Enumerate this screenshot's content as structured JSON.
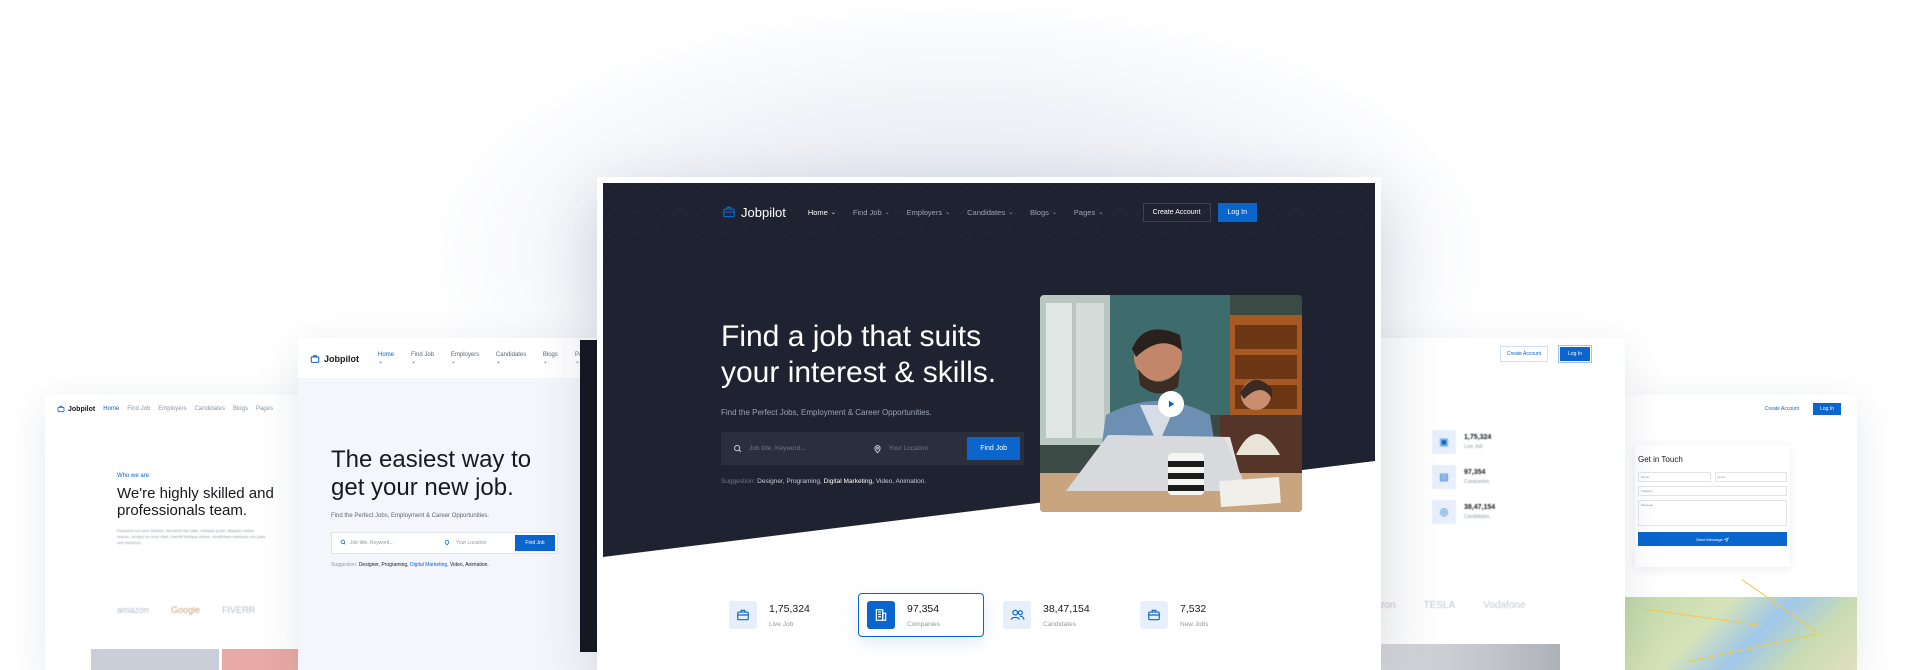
{
  "colors": {
    "brand": "#0a65cc",
    "dark_hero": "#1f2230",
    "text": "#18191c",
    "muted": "#9199a3"
  },
  "main": {
    "logo": "Jobpilot",
    "nav": [
      {
        "label": "Home",
        "active": true
      },
      {
        "label": "Find Job"
      },
      {
        "label": "Employers"
      },
      {
        "label": "Candidates"
      },
      {
        "label": "Blogs"
      },
      {
        "label": "Pages"
      }
    ],
    "create_account": "Create Account",
    "login": "Log In",
    "hero_title": "Find a job that suits your interest & skills.",
    "hero_subtitle": "Find the Perfect Jobs, Employment & Career Opportunities.",
    "search": {
      "keyword_placeholder": "Job title, Keyword...",
      "location_placeholder": "Your Location",
      "button": "Find Job"
    },
    "suggestion_label": "Suggestion:",
    "suggestions": [
      "Designer,",
      "Programing,",
      "Digital Marketing,",
      "Video,",
      "Animation."
    ],
    "stats": [
      {
        "value": "1,75,324",
        "label": "Live Job",
        "icon": "briefcase-icon"
      },
      {
        "value": "97,354",
        "label": "Companies",
        "icon": "building-icon"
      },
      {
        "value": "38,47,154",
        "label": "Candidates",
        "icon": "users-icon"
      },
      {
        "value": "7,532",
        "label": "New Jobs",
        "icon": "briefcase-icon"
      }
    ]
  },
  "left": {
    "logo": "Jobpilot",
    "nav": [
      "Home",
      "Find Job",
      "Employers",
      "Candidates",
      "Blogs",
      "Pages"
    ],
    "title": "The easiest way to get your new job.",
    "subtitle": "Find the Perfect Jobs, Employment & Career Opportunities.",
    "keyword_placeholder": "Job title, Keyword...",
    "location_placeholder": "Your Location",
    "button": "Find Job",
    "suggestion_label": "Suggestion:",
    "suggestions": [
      "Designer,",
      "Programing,",
      "Digital Marketing,",
      "Video,",
      "Animation."
    ]
  },
  "far_left": {
    "logo": "Jobpilot",
    "nav": [
      "Home",
      "Find Job",
      "Employers",
      "Candidates",
      "Blogs",
      "Pages"
    ],
    "kicker": "Who we are",
    "title": "We're highly skilled and professionals team.",
    "paragraph": "Praesent non sem facilisis, hendrerit nisi vitae, volutpat quam. Aliquam metus mauris, semper eu eros vitae, blandit tristique metus. Vestibulum maximus nec justo sed maximus.",
    "brands": [
      "amazon",
      "Google",
      "FIVERR"
    ]
  },
  "right": {
    "create_account": "Create Account",
    "login": "Log In",
    "stats": [
      {
        "value": "1,75,324",
        "label": "Live Job"
      },
      {
        "value": "97,354",
        "label": "Companies"
      },
      {
        "value": "38,47,154",
        "label": "Candidates"
      }
    ],
    "logos": [
      "amazon",
      "TESLA",
      "Vodafone"
    ]
  },
  "far_right": {
    "create_account": "Create Account",
    "login": "Log In",
    "form_title": "Get in Touch",
    "name_ph": "Name",
    "email_ph": "Email",
    "subject_ph": "Subjects",
    "message_ph": "Message",
    "send": "Send Message"
  }
}
